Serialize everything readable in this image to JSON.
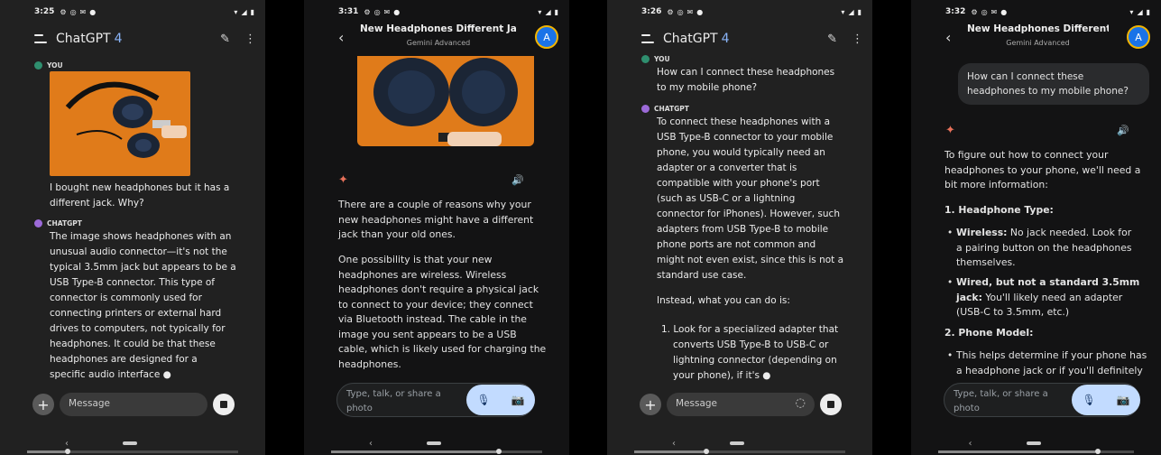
{
  "status_times": [
    "3:25",
    "3:31",
    "3:26",
    "3:32"
  ],
  "panel1": {
    "app_title": "ChatGPT",
    "app_version": "4",
    "you_label": "YOU",
    "user_message": "I bought new headphones but it has a different jack. Why?",
    "bot_label": "CHATGPT",
    "bot_lines": [
      "The image shows headphones with an",
      "unusual audio connector—it's not the",
      "typical 3.5mm jack but appears to be a",
      "USB Type-B connector. This type of",
      "connector is commonly used for",
      "connecting printers or external hard",
      "drives to computers, not typically for",
      "headphones. It could be that these",
      "headphones are designed for a",
      "specific audio interface"
    ],
    "input_placeholder": "Message"
  },
  "panel2": {
    "title": "New Headphones Different Ja...",
    "subtitle": "Gemini Advanced",
    "avatar_letter": "A",
    "para1": [
      "There are a couple of reasons why your",
      "new headphones might have a different",
      "jack than your old ones."
    ],
    "para2": [
      "One possibility is that your new",
      "headphones are wireless. Wireless",
      "headphones don't require a physical jack",
      "to connect to your device; they connect",
      "via Bluetooth instead. The cable in the",
      "image you sent appears to be a USB",
      "cable, which is likely used for charging the",
      "headphones."
    ],
    "input_placeholder": "Type, talk, or share a photo"
  },
  "panel3": {
    "app_title": "ChatGPT",
    "app_version": "4",
    "you_label": "YOU",
    "user_lines": [
      "How can I connect these headphones",
      "to my mobile phone?"
    ],
    "bot_label": "CHATGPT",
    "bot_lines": [
      "To connect these headphones with a",
      "USB Type-B connector to your mobile",
      "phone, you would typically need an",
      "adapter or a converter that is",
      "compatible with your phone's port",
      "(such as USB-C or a lightning",
      "connector for iPhones). However, such",
      "adapters from USB Type-B to mobile",
      "phone ports are not common and",
      "might not even exist, since this is not a",
      "standard use case."
    ],
    "instead": "Instead, what you can do is:",
    "step_lines": [
      "1.  Look for a specialized adapter that",
      "converts USB Type-B to USB-C or",
      "lightning connector (depending on",
      "your phone), if it's"
    ],
    "input_placeholder": "Message"
  },
  "panel4": {
    "title": "New Headphones Different Ja...",
    "subtitle": "Gemini Advanced",
    "avatar_letter": "A",
    "user_lines": [
      "How can I connect these",
      "headphones to my mobile phone?"
    ],
    "intro_lines": [
      "To figure out how to connect your",
      "headphones to your phone, we'll need a",
      "bit more information:"
    ],
    "h1": "1. Headphone Type:",
    "b1_bold": "Wireless:",
    "b1_lines": [
      " No jack needed. Look for",
      "a pairing button on the headphones",
      "themselves."
    ],
    "b2_bold_lines": [
      "Wired, but not a standard 3.5mm",
      "jack:"
    ],
    "b2_lines": [
      " You'll likely need an adapter",
      "(USB-C to 3.5mm, etc.)"
    ],
    "h2": "2. Phone Model:",
    "b3_lines": [
      "This helps determine if your phone has",
      "a headphone jack or if you'll definitely"
    ],
    "input_placeholder": "Type, talk, or share a photo"
  },
  "icons": {
    "sparkle": "✦",
    "speaker": "🔊",
    "mic": "🎙",
    "camera": "📷"
  }
}
